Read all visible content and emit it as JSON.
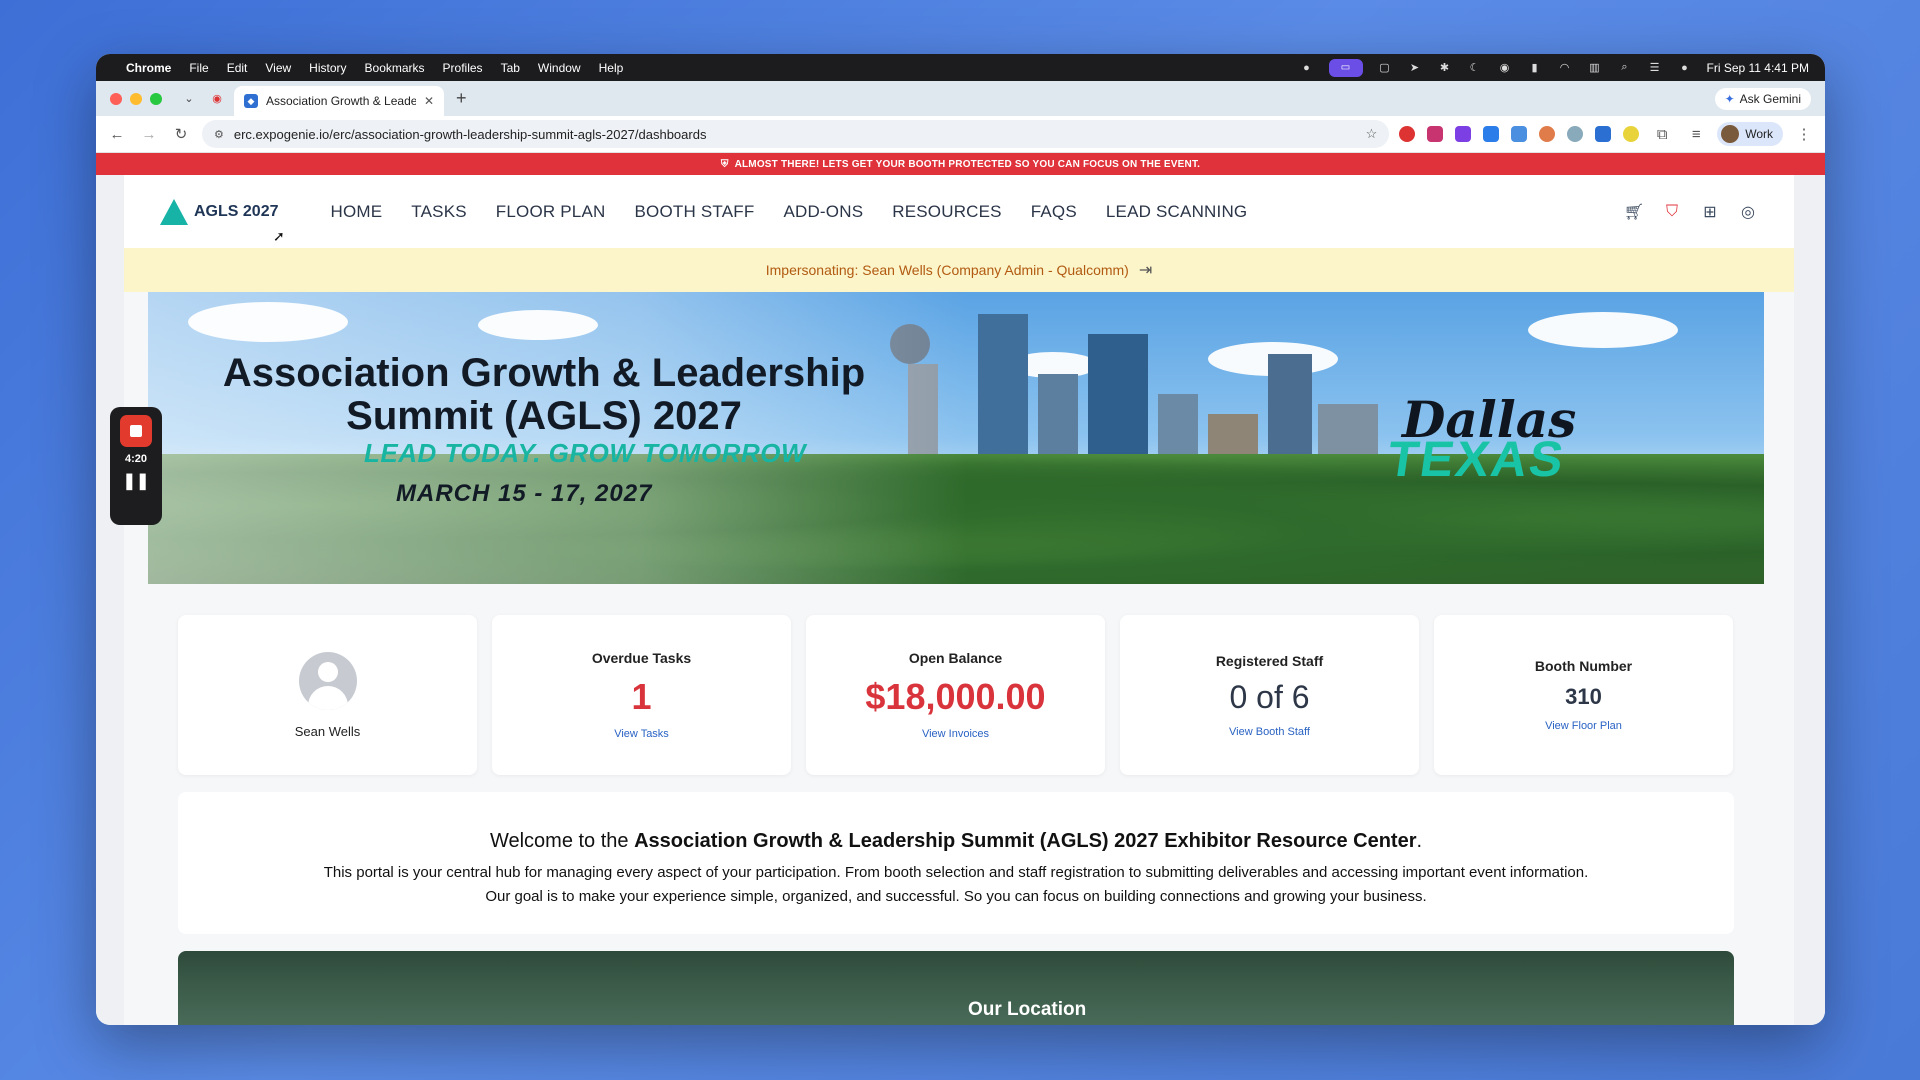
{
  "macos_menubar": {
    "items": [
      "Chrome",
      "File",
      "Edit",
      "View",
      "History",
      "Bookmarks",
      "Profiles",
      "Tab",
      "Window",
      "Help"
    ],
    "clock": "Fri Sep 11  4:41 PM"
  },
  "browser": {
    "tab_title": "Association Growth & Leader",
    "url": "erc.expogenie.io/erc/association-growth-leadership-summit-agls-2027/dashboards",
    "ask_gemini": "Ask Gemini",
    "profile": "Work"
  },
  "alert_banner": "ALMOST THERE! LETS GET YOUR BOOTH PROTECTED SO YOU CAN FOCUS ON THE EVENT.",
  "site": {
    "logo_text": "AGLS 2027",
    "nav": [
      "HOME",
      "TASKS",
      "FLOOR PLAN",
      "BOOTH STAFF",
      "ADD-ONS",
      "RESOURCES",
      "FAQS",
      "LEAD SCANNING"
    ],
    "impersonating": "Impersonating: Sean Wells (Company Admin - Qualcomm)"
  },
  "hero": {
    "title": "Association Growth & Leadership Summit (AGLS) 2027",
    "tagline": "LEAD TODAY. GROW TOMORROW",
    "dates": "MARCH 15 - 17, 2027",
    "city": "Dallas",
    "state": "TEXAS"
  },
  "stats": {
    "user_name": "Sean Wells",
    "overdue_label": "Overdue Tasks",
    "overdue_value": "1",
    "overdue_link": "View Tasks",
    "balance_label": "Open Balance",
    "balance_value": "$18,000.00",
    "balance_link": "View Invoices",
    "staff_label": "Registered Staff",
    "staff_value": "0 of 6",
    "staff_link": "View Booth Staff",
    "booth_label": "Booth Number",
    "booth_value": "310",
    "booth_link": "View Floor Plan"
  },
  "welcome": {
    "prefix": "Welcome to the ",
    "bold": "Association Growth & Leadership Summit (AGLS) 2027 Exhibitor Resource Center",
    "suffix": ".",
    "line1": "This portal is your central hub for managing every aspect of your participation. From booth selection and staff registration to submitting deliverables and accessing important event information.",
    "line2": "Our goal is to make your experience simple, organized, and successful. So you can focus on building connections and growing your business."
  },
  "location_title": "Our Location",
  "recorder": {
    "time": "4:20"
  }
}
